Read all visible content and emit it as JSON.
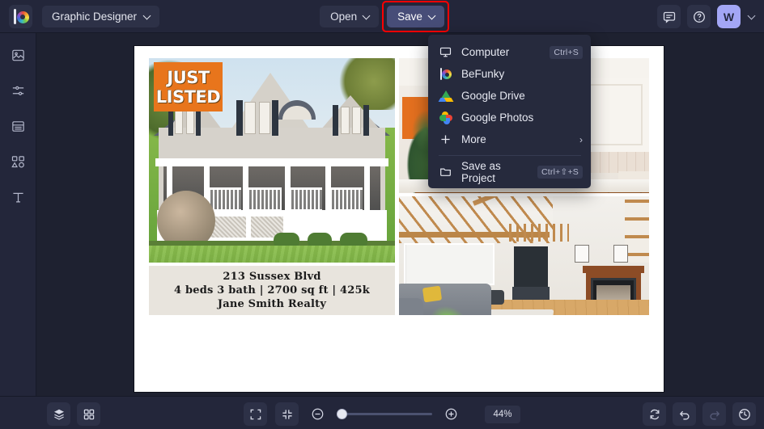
{
  "app": {
    "name": "BeFunky",
    "logo_icon": "befunky-logo-icon"
  },
  "topbar": {
    "project_type": "Graphic Designer",
    "open_label": "Open",
    "save_label": "Save",
    "chevron_icon": "chevron-down-icon",
    "feedback_icon": "chat-bubble-icon",
    "help_icon": "question-circle-icon",
    "avatar_initial": "W",
    "save_highlight_color": "#ff0000",
    "save_button_color": "#474d78",
    "avatar_color": "#a3a6f5"
  },
  "sidebar": {
    "items": [
      {
        "name": "image",
        "icon": "image-icon"
      },
      {
        "name": "edit",
        "icon": "sliders-icon"
      },
      {
        "name": "templates",
        "icon": "template-icon"
      },
      {
        "name": "graphics",
        "icon": "shapes-icon"
      },
      {
        "name": "text",
        "icon": "text-icon"
      }
    ]
  },
  "save_menu": {
    "items": [
      {
        "label": "Computer",
        "icon": "monitor-icon",
        "shortcut": "Ctrl+S"
      },
      {
        "label": "BeFunky",
        "icon": "befunky-logo-icon",
        "shortcut": ""
      },
      {
        "label": "Google Drive",
        "icon": "google-drive-icon",
        "shortcut": ""
      },
      {
        "label": "Google Photos",
        "icon": "google-photos-icon",
        "shortcut": ""
      },
      {
        "label": "More",
        "icon": "plus-icon",
        "shortcut": "",
        "submenu_arrow": "›"
      }
    ],
    "footer": {
      "label": "Save as Project",
      "icon": "folder-icon",
      "shortcut": "Ctrl+⇧+S"
    }
  },
  "canvas": {
    "badge": {
      "line1": "JUST",
      "line2": "LISTED",
      "color": "#e8751c"
    },
    "photos": [
      {
        "name": "house-exterior-photo",
        "alt": "Gray shingle house with white wraparound porch and green lawn"
      },
      {
        "name": "kitchen-photo",
        "alt": "White kitchen with wood island and leather bar stools"
      },
      {
        "name": "living-room-photo",
        "alt": "Living room with fireplace, gray sofa and wood floors"
      }
    ],
    "info_card": {
      "address": "213 Sussex Blvd",
      "details": "4 beds 3 bath | 2700 sq ft | 425k",
      "realty": "Jane Smith Realty",
      "background": "#e8e4dd"
    }
  },
  "bottombar": {
    "layers_icon": "layers-icon",
    "grid_icon": "grid-icon",
    "fit_icon": "fit-screen-icon",
    "shrink_icon": "collapse-icon",
    "zoom_out_icon": "minus-circle-icon",
    "zoom_in_icon": "plus-circle-icon",
    "zoom_level": "44%",
    "zoom_percent": 44,
    "reset_icon": "reset-icon",
    "undo_icon": "undo-icon",
    "redo_icon": "redo-icon",
    "history_icon": "history-icon"
  }
}
